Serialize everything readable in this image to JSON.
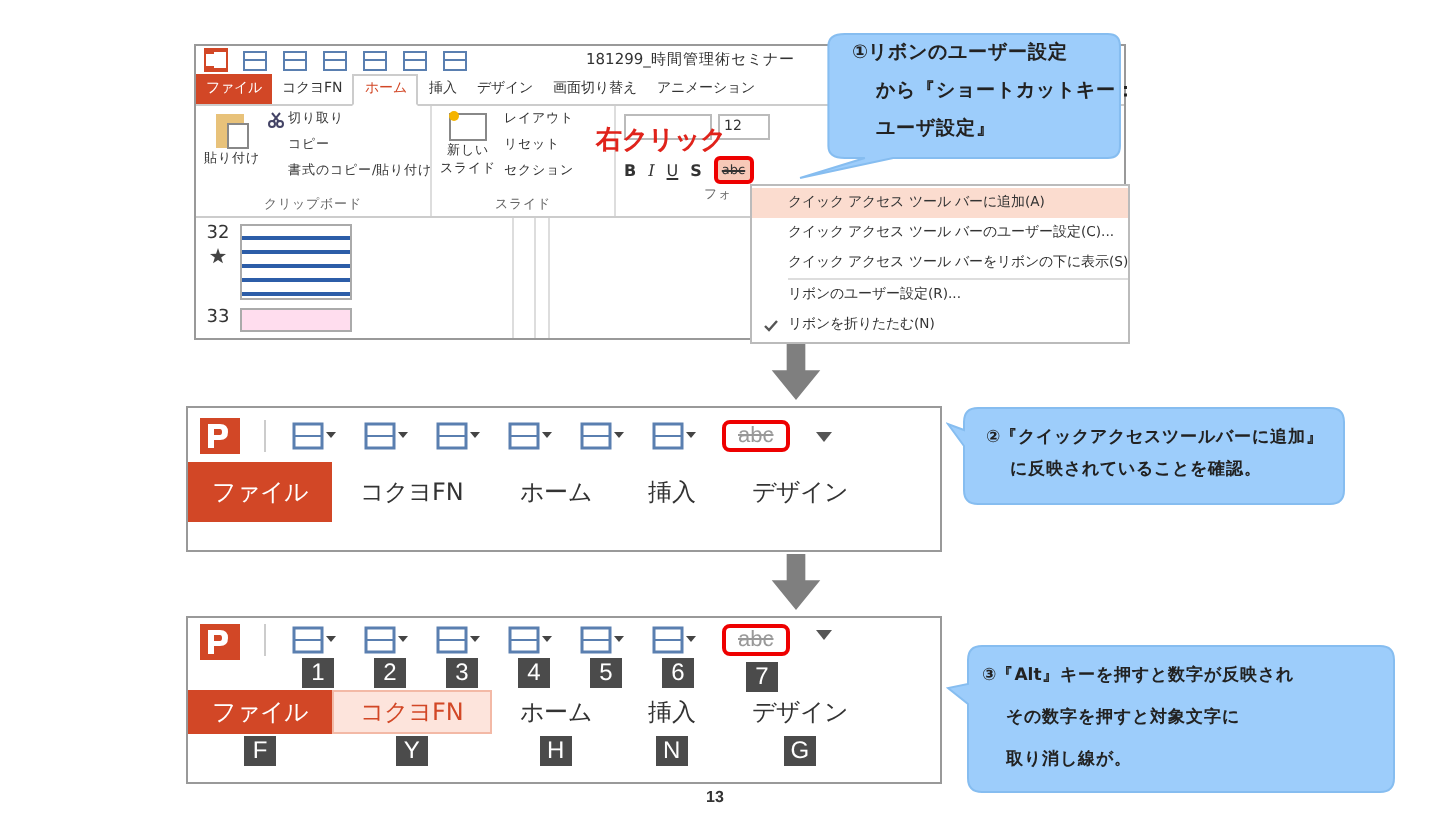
{
  "step_1": {
    "app_title": "181299_時間管理術セミナー",
    "tabs": [
      {
        "label": "ファイル",
        "kind": "file",
        "selected": false
      },
      {
        "label": "コクヨFN",
        "kind": "tab",
        "selected": false
      },
      {
        "label": "ホーム",
        "kind": "tab",
        "selected": true
      },
      {
        "label": "挿入",
        "kind": "tab",
        "selected": false
      },
      {
        "label": "デザイン",
        "kind": "tab",
        "selected": false
      },
      {
        "label": "画面切り替え",
        "kind": "tab",
        "selected": false
      },
      {
        "label": "アニメーション",
        "kind": "tab",
        "selected": false
      }
    ],
    "clipboard": {
      "paste": "貼り付け",
      "cut": "切り取り",
      "copy": "コピー",
      "format_painter": "書式のコピー/貼り付け",
      "group": "クリップボード"
    },
    "slides": {
      "new_slide": "新しい",
      "new_slide_2": "スライド",
      "layout": "レイアウト",
      "reset": "リセット",
      "section": "セクション",
      "group": "スライド"
    },
    "font": {
      "size": "12",
      "bold": "B",
      "italic": "I",
      "underline": "U",
      "shadow": "S",
      "strike": "abc",
      "group": "フォ"
    },
    "thumbnails": [
      {
        "number": "32",
        "starred": true
      },
      {
        "number": "33",
        "starred": false
      }
    ],
    "right_click_label": "右クリック",
    "context_menu": [
      {
        "label": "クイック アクセス ツール バーに追加(A)",
        "selected": true,
        "checked": false
      },
      {
        "label": "クイック アクセス ツール バーのユーザー設定(C)...",
        "selected": false,
        "checked": false
      },
      {
        "label": "クイック アクセス ツール バーをリボンの下に表示(S)",
        "selected": false,
        "checked": false
      },
      {
        "label": "リボンのユーザー設定(R)...",
        "selected": false,
        "checked": false
      },
      {
        "label": "リボンを折りたたむ(N)",
        "selected": false,
        "checked": true
      }
    ],
    "callout": [
      "①リボンのユーザー設定",
      "から『ショートカットキー：",
      "ユーザ設定』"
    ]
  },
  "step_2": {
    "strike": "abc",
    "tabs": [
      {
        "label": "ファイル",
        "kind": "file",
        "selected": false
      },
      {
        "label": "コクヨFN",
        "kind": "tab",
        "selected": false
      },
      {
        "label": "ホーム",
        "kind": "tab",
        "selected": false
      },
      {
        "label": "挿入",
        "kind": "tab",
        "selected": false
      },
      {
        "label": "デザイン",
        "kind": "tab",
        "selected": false
      }
    ],
    "callout": [
      "②『クイックアクセスツールバーに追加』",
      "に反映されていることを確認。"
    ]
  },
  "step_3": {
    "strike": "abc",
    "qat_keytips": [
      "1",
      "2",
      "3",
      "4",
      "5",
      "6",
      "7"
    ],
    "tabs": [
      {
        "label": "ファイル",
        "kind": "file",
        "selected": false,
        "keytip": "F"
      },
      {
        "label": "コクヨFN",
        "kind": "tab",
        "selected": true,
        "keytip": "Y"
      },
      {
        "label": "ホーム",
        "kind": "tab",
        "selected": false,
        "keytip": "H"
      },
      {
        "label": "挿入",
        "kind": "tab",
        "selected": false,
        "keytip": "N"
      },
      {
        "label": "デザイン",
        "kind": "tab",
        "selected": false,
        "keytip": "G"
      }
    ],
    "callout": [
      "③『Alt』キーを押すと数字が反映され",
      "その数字を押すと対象文字に",
      "取り消し線が。"
    ]
  },
  "page_number": "13"
}
